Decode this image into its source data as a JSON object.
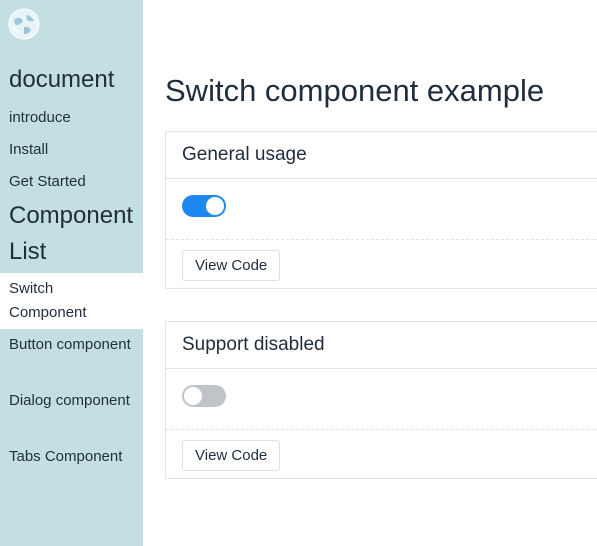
{
  "sidebar": {
    "logo_icon": "globe-logo-icon",
    "doc_heading": "document",
    "doc_links": [
      "introduce",
      "Install",
      "Get Started"
    ],
    "component_heading": "Component List",
    "components": [
      {
        "label": "Switch Component",
        "active": true
      },
      {
        "label": "Button component",
        "active": false
      },
      {
        "label": "Dialog component",
        "active": false
      },
      {
        "label": "Tabs Component",
        "active": false
      }
    ]
  },
  "main": {
    "title": "Switch component example",
    "cards": [
      {
        "title": "General usage",
        "switch_state": "on",
        "button_label": "View Code"
      },
      {
        "title": "Support disabled",
        "switch_state": "off-disabled",
        "button_label": "View Code"
      }
    ]
  },
  "colors": {
    "sidebar_bg": "#c4dfe2",
    "switch_on": "#1e88f0",
    "switch_off": "#c0c4c8",
    "text": "#1f2d3d"
  }
}
